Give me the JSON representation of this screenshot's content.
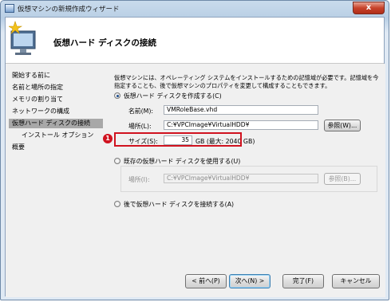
{
  "window": {
    "title": "仮想マシンの新規作成ウィザード",
    "close_label": "x"
  },
  "header": {
    "title": "仮想ハード ディスクの接続"
  },
  "nav": {
    "items": [
      {
        "label": "開始する前に"
      },
      {
        "label": "名前と場所の指定"
      },
      {
        "label": "メモリの割り当て"
      },
      {
        "label": "ネットワークの構成"
      },
      {
        "label": "仮想ハード ディスクの接続"
      },
      {
        "label": "インストール オプション"
      },
      {
        "label": "概要"
      }
    ],
    "selected_index": 4
  },
  "content": {
    "description": "仮想マシンには、オペレーティング システムをインストールするための記憶域が必要です。記憶域を今指定することも、後で仮想マシンのプロパティを変更して構成することもできます。",
    "option_create": {
      "label": "仮想ハード ディスクを作成する(C)",
      "selected": true,
      "name_label": "名前(M):",
      "name_value": "VMRoleBase.vhd",
      "location_label": "場所(L):",
      "location_value": "C:¥VPCImage¥VirtualHDD¥",
      "browse_label": "参照(W)...",
      "size_label": "サイズ(S):",
      "size_value": "35",
      "size_unit": "GB (最大: 2040 GB)"
    },
    "option_existing": {
      "label": "既存の仮想ハード ディスクを使用する(U)",
      "selected": false,
      "location_label": "場所(I):",
      "location_value": "C:¥VPCImage¥VirtualHDD¥",
      "browse_label": "参照(B)..."
    },
    "option_later": {
      "label": "後で仮想ハード ディスクを接続する(A)",
      "selected": false
    },
    "callout_number": "1"
  },
  "footer": {
    "prev_label": "< 前へ(P)",
    "next_label": "次へ(N) >",
    "finish_label": "完了(F)",
    "cancel_label": "キャンセル"
  },
  "colors": {
    "accent_red": "#d0121f",
    "selected_nav": "#a8a8a8"
  }
}
